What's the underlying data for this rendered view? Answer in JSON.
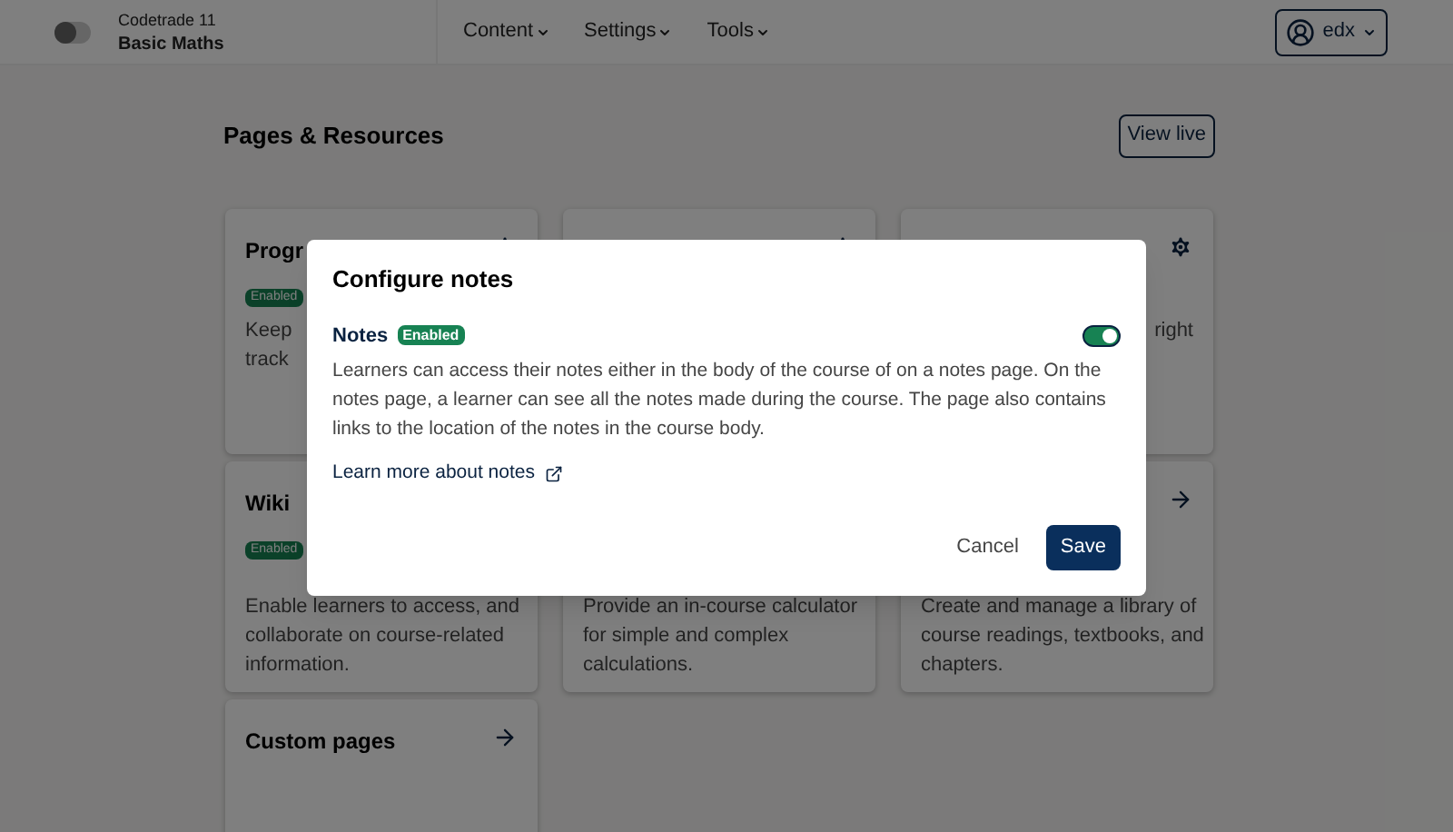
{
  "header": {
    "org": "Codetrade 11",
    "course": "Basic Maths",
    "nav": [
      {
        "label": "Content"
      },
      {
        "label": "Settings"
      },
      {
        "label": "Tools"
      }
    ],
    "user": "edx"
  },
  "page": {
    "title": "Pages & Resources",
    "view_live": "View live"
  },
  "cards": [
    {
      "kind": "settings",
      "title": "Progr",
      "badge": "Enabled",
      "lines": [
        "Keep",
        "track"
      ]
    },
    {
      "kind": "settings"
    },
    {
      "kind": "settings",
      "lines": [
        "right"
      ]
    },
    {
      "kind": "plain",
      "title": "Wiki",
      "badge": "Enabled",
      "lines": [
        "Enable learners to access, and",
        "collaborate on course-related",
        "information."
      ]
    },
    {
      "kind": "plain",
      "lines": [
        "Provide an in-course calculator",
        "for simple and complex",
        "calculations."
      ]
    },
    {
      "kind": "link",
      "lines": [
        "Create and manage a library of",
        "course readings, textbooks, and",
        "chapters."
      ]
    },
    {
      "kind": "link",
      "title": "Custom pages"
    }
  ],
  "modal": {
    "title": "Configure notes",
    "toggle": {
      "label": "Notes",
      "badge": "Enabled",
      "on": true
    },
    "description": "Learners can access their notes either in the body of the course of on a notes page. On the notes page, a learner can see all the notes made during the course. The page also contains links to the location of the notes in the course body.",
    "link": "Learn more about notes",
    "cancel": "Cancel",
    "save": "Save"
  }
}
